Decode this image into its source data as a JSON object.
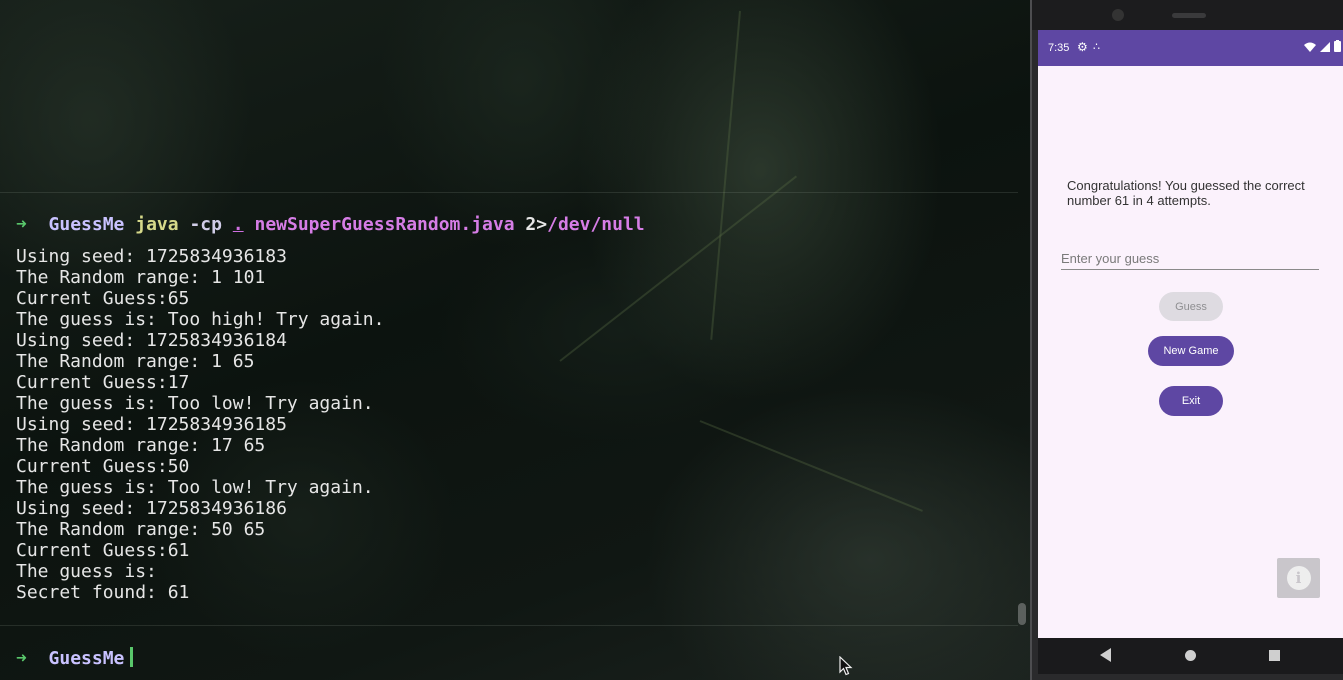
{
  "terminal": {
    "command": {
      "prompt_arrow": "➜",
      "directory": "GuessMe",
      "program": "java",
      "flag": "-cp",
      "classpath": ".",
      "file": "newSuperGuessRandom.java",
      "redirect": "2>",
      "redirect_target": "/dev/null"
    },
    "output_lines": [
      "Using seed: 1725834936183",
      "The Random range: 1 101",
      "Current Guess:65",
      "The guess is: Too high! Try again.",
      "Using seed: 1725834936184",
      "The Random range: 1 65",
      "Current Guess:17",
      "The guess is: Too low! Try again.",
      "Using seed: 1725834936185",
      "The Random range: 17 65",
      "Current Guess:50",
      "The guess is: Too low! Try again.",
      "Using seed: 1725834936186",
      "The Random range: 50 65",
      "Current Guess:61",
      "The guess is:",
      "Secret found: 61"
    ],
    "prompt": {
      "arrow": "➜",
      "directory": "GuessMe"
    }
  },
  "phone": {
    "status_bar": {
      "time": "7:35",
      "settings_icon": "gear-icon",
      "right_icons": "wifi signal battery"
    },
    "app": {
      "message": "Congratulations! You guessed the correct number 61 in 4 attempts.",
      "input_placeholder": "Enter your guess",
      "guess_button": "Guess",
      "new_game_button": "New Game",
      "exit_button": "Exit",
      "info_icon": "info-icon"
    },
    "colors": {
      "accent": "#5e47a3",
      "background": "#fbf2fc"
    }
  }
}
